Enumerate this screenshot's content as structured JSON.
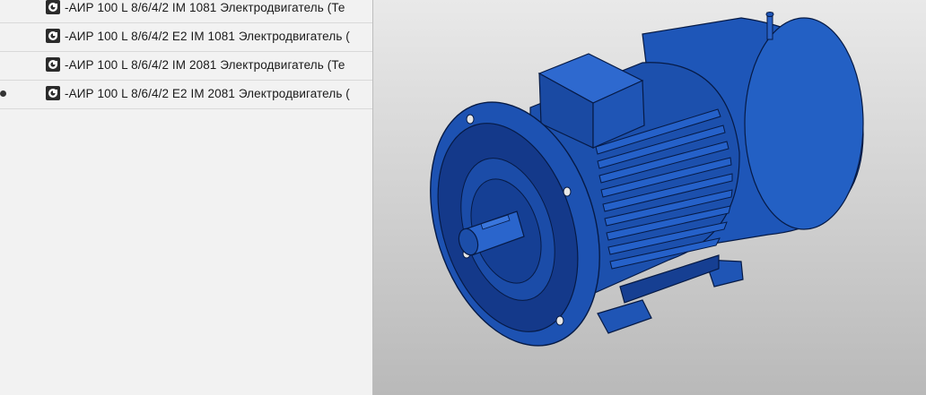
{
  "tree": {
    "items": [
      {
        "label": "-АИР 100 L 8/6/4/2 IM 1081 Электродвигатель  (Те",
        "icon": "part-icon",
        "marked": false
      },
      {
        "label": "-АИР 100 L 8/6/4/2 E2 IM 1081 Электродвигатель  (",
        "icon": "part-icon",
        "marked": false
      },
      {
        "label": "-АИР 100 L 8/6/4/2 IM 2081 Электродвигатель  (Те",
        "icon": "part-icon",
        "marked": false
      },
      {
        "label": "-АИР 100 L 8/6/4/2 E2 IM 2081 Электродвигатель  (",
        "icon": "part-icon",
        "marked": true
      }
    ]
  },
  "viewport": {
    "model": "electric-motor-3d-model",
    "colors": {
      "body": "#1e56b8",
      "body_dark": "#123a86",
      "body_light": "#3a73d6",
      "edge": "#061a45",
      "background_top": "#e9e9e9",
      "background_bottom": "#b9b9b9"
    }
  }
}
